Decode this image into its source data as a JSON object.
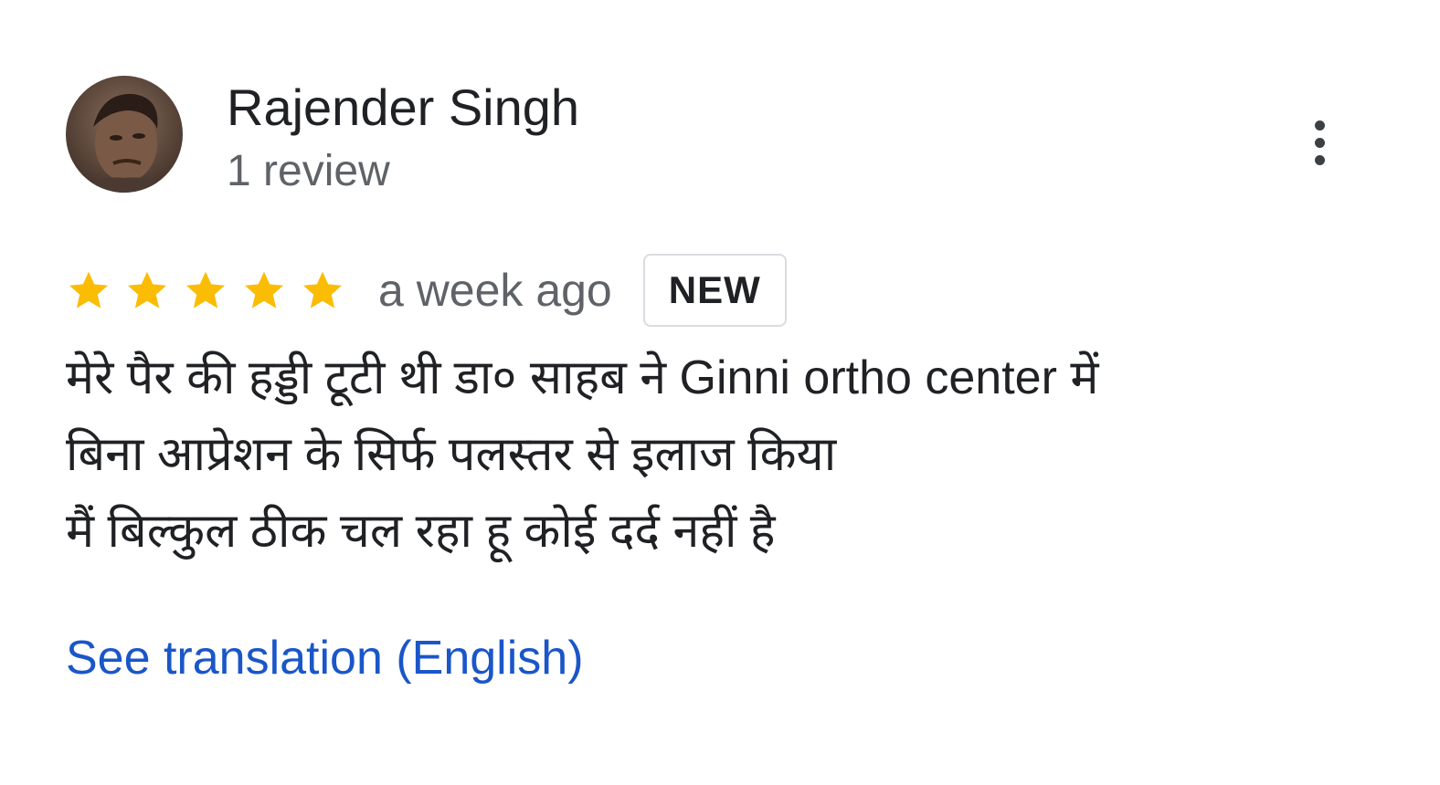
{
  "review": {
    "reviewer_name": "Rajender Singh",
    "review_count": "1 review",
    "rating": 5,
    "rating_max": 5,
    "date": "a week ago",
    "badge": "NEW",
    "text_lines": [
      "मेरे पैर की हड्डी टूटी थी डा० साहब ने Ginni ortho center में",
      "बिना आप्रेशन के सिर्फ पलस्तर से इलाज किया",
      "मैं बिल्कुल ठीक चल रहा हू कोई दर्द नहीं है"
    ],
    "translate_label": "See translation (English)"
  },
  "icons": {
    "menu": "more-vertical-icon",
    "star": "star-icon"
  },
  "colors": {
    "star": "#fbbc04",
    "link": "#1a56c8",
    "secondary_text": "#5f6368",
    "primary_text": "#202124"
  }
}
